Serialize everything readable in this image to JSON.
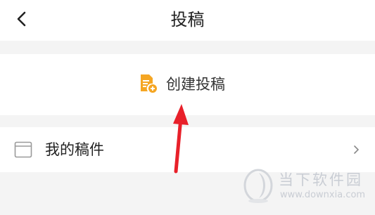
{
  "header": {
    "title": "投稿",
    "back_icon": "back-chevron-icon"
  },
  "create": {
    "label": "创建投稿",
    "icon": "create-draft-icon",
    "icon_color": "#f5a623"
  },
  "drafts": {
    "label": "我的稿件",
    "icon": "drafts-folder-icon",
    "chevron_icon": "chevron-right-icon"
  },
  "annotation": {
    "arrow_color": "#e8202a"
  },
  "watermark": {
    "name": "当下软件园",
    "url": "www.downxia.com"
  },
  "colors": {
    "background": "#f4f4f4",
    "surface": "#ffffff",
    "text": "#222222"
  }
}
